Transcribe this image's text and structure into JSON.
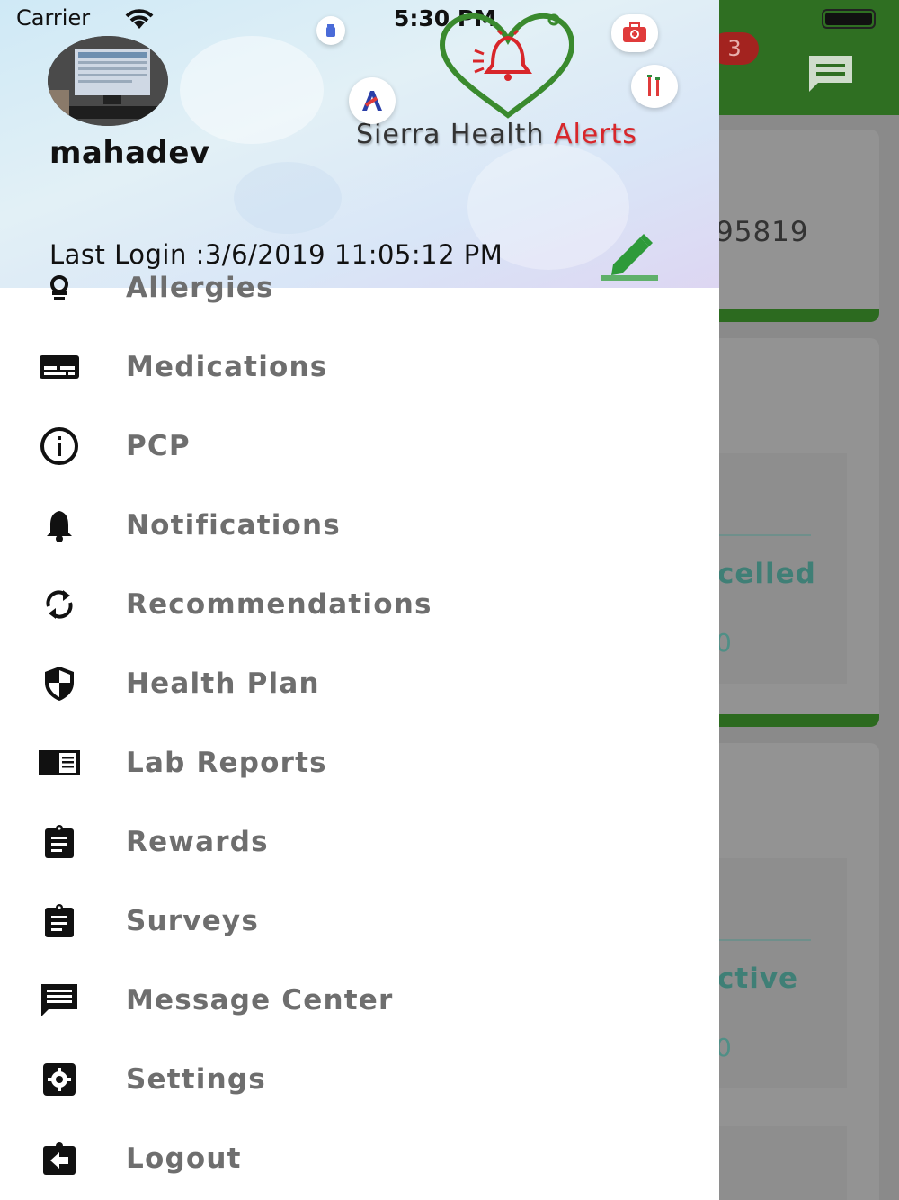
{
  "status_bar": {
    "carrier": "Carrier",
    "time": "5:30 PM"
  },
  "user": {
    "name": "mahadev",
    "last_login": "Last Login :3/6/2019 11:05:12 PM"
  },
  "brand": {
    "name_part1": "Sierra Health",
    "name_part2": "Alerts",
    "accent_color": "#d8262a",
    "logo_color": "#3a8a2e"
  },
  "background_app": {
    "notification_count": "3",
    "id_fragment": "95819",
    "status_1": "celled",
    "status_2": "ctive",
    "value_1": "0",
    "value_2": "0",
    "header_color": "#2f6f22"
  },
  "menu": {
    "partial_top": {
      "label": "Allergies",
      "icon": "allergy-icon"
    },
    "items": [
      {
        "label": "Medications",
        "icon": "medications-icon"
      },
      {
        "label": "PCP",
        "icon": "info-icon"
      },
      {
        "label": "Notifications",
        "icon": "bell-icon"
      },
      {
        "label": "Recommendations",
        "icon": "sync-icon"
      },
      {
        "label": "Health Plan",
        "icon": "shield-icon"
      },
      {
        "label": "Lab Reports",
        "icon": "report-icon"
      },
      {
        "label": "Rewards",
        "icon": "clipboard-icon"
      },
      {
        "label": "Surveys",
        "icon": "clipboard-icon"
      },
      {
        "label": "Message Center",
        "icon": "message-icon"
      },
      {
        "label": "Settings",
        "icon": "settings-icon"
      },
      {
        "label": "Logout",
        "icon": "logout-icon"
      }
    ]
  }
}
